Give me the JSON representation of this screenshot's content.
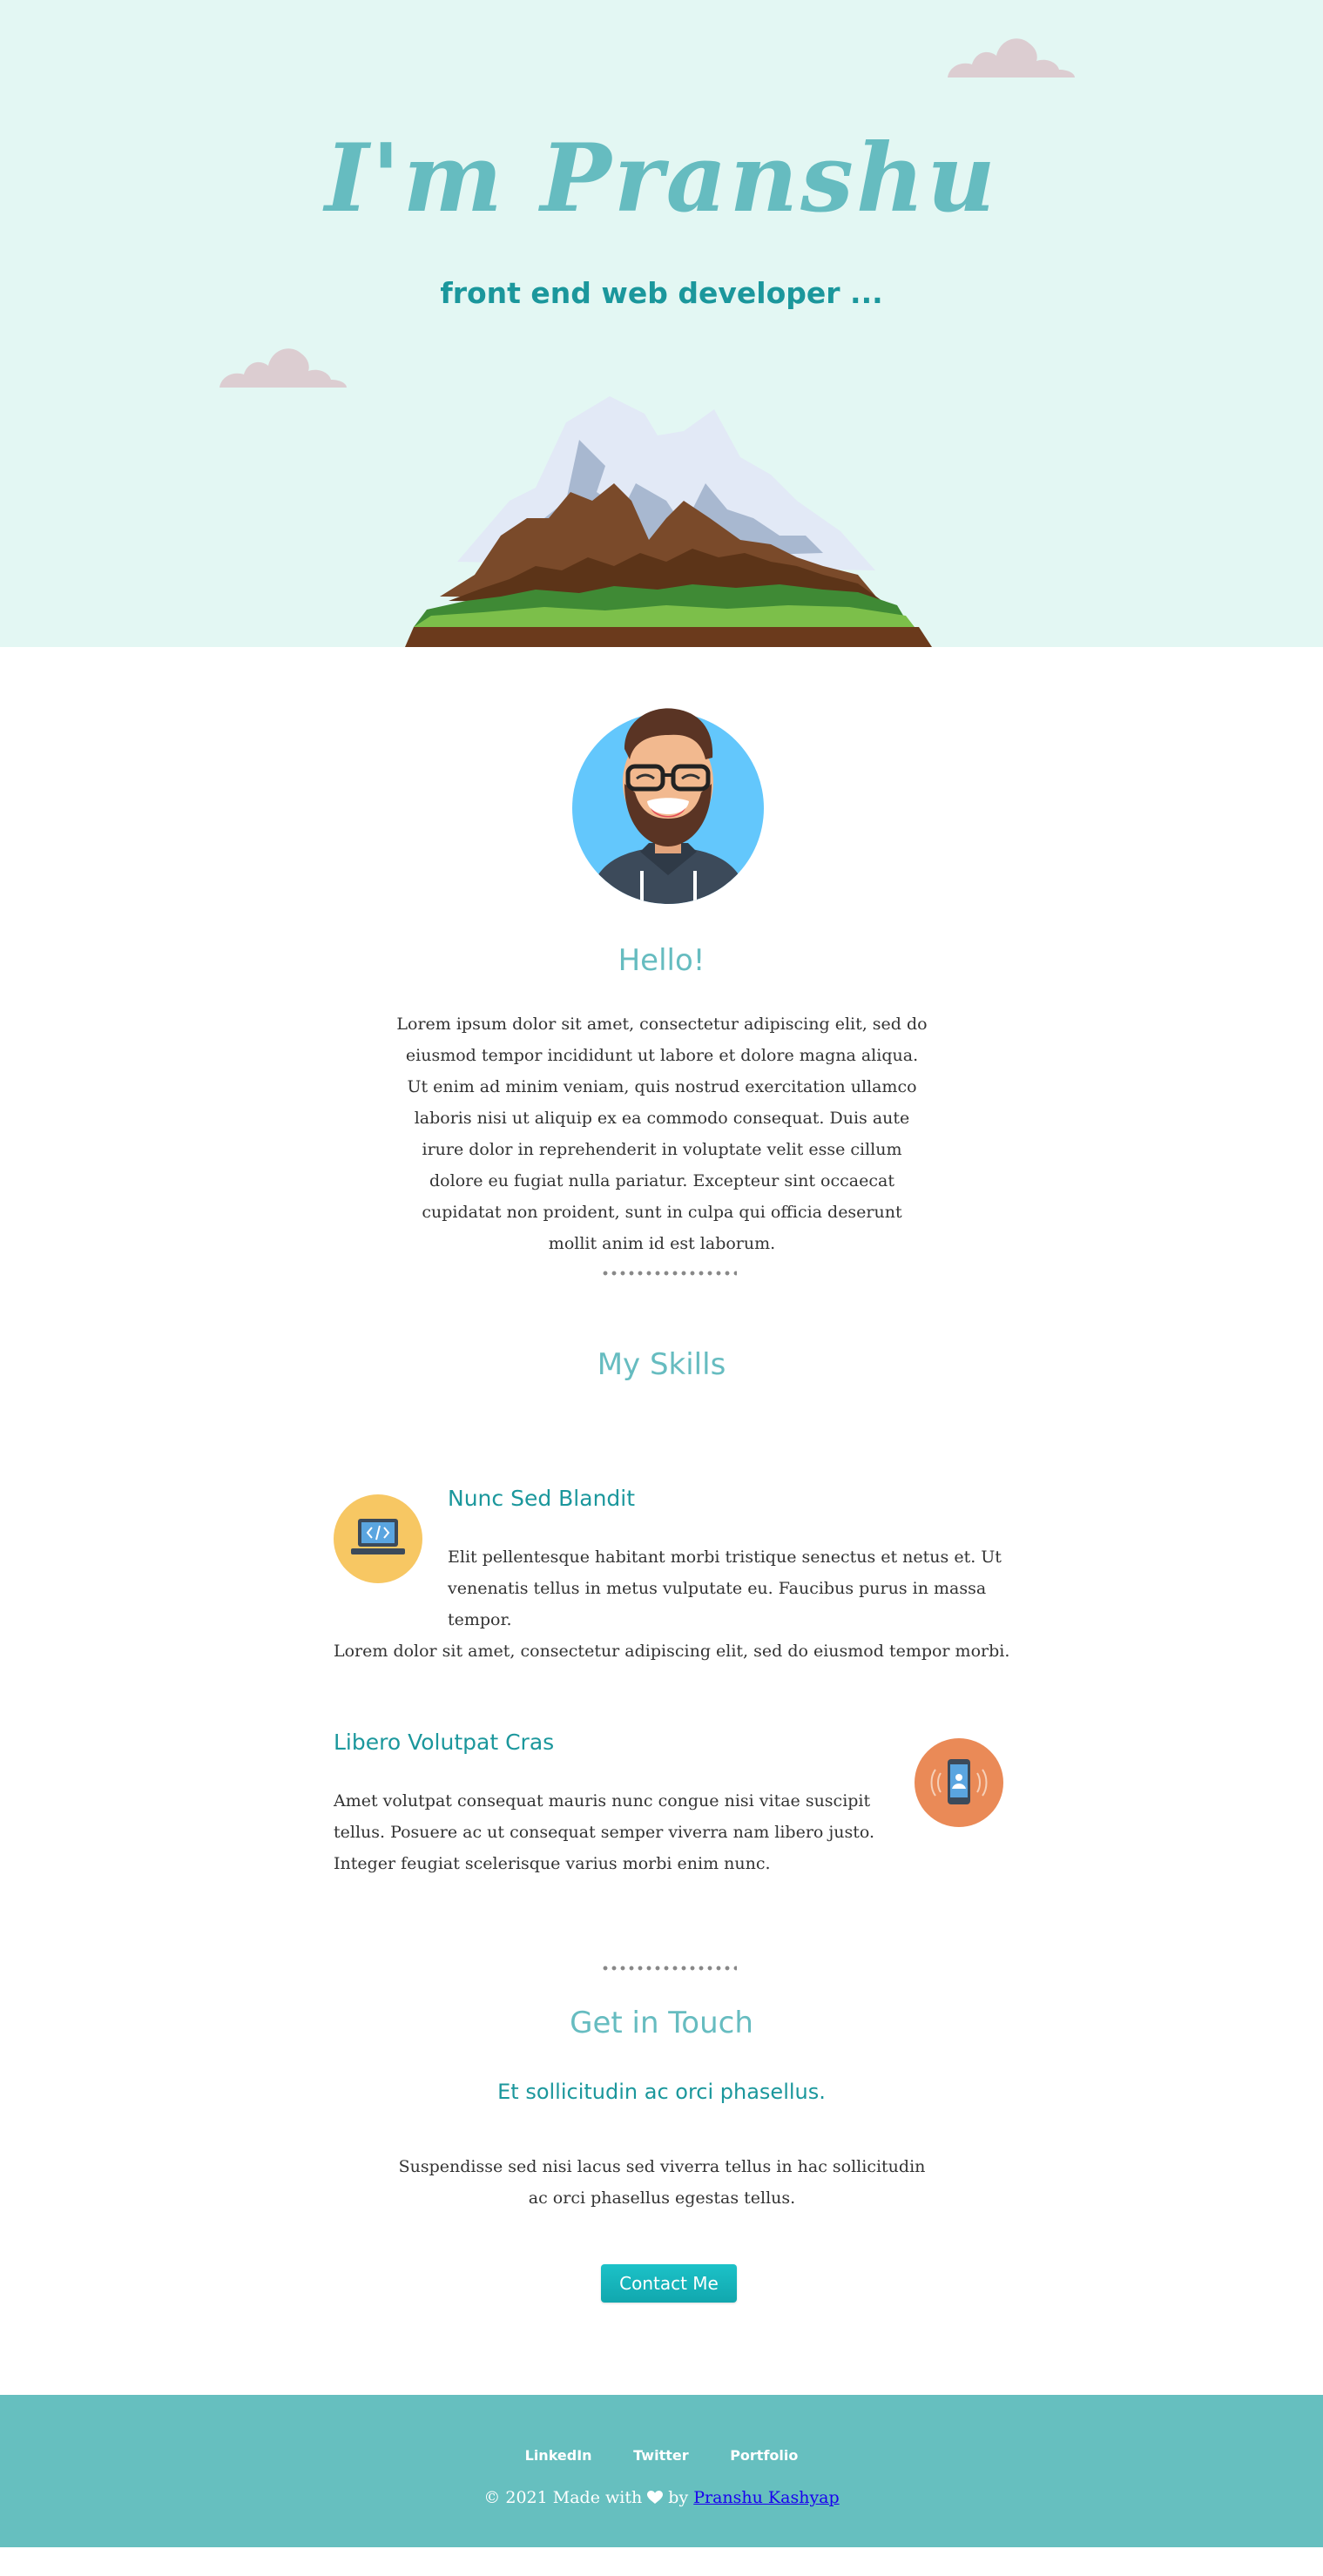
{
  "hero": {
    "title": "I'm Pranshu",
    "subtitle": "front end web developer ..."
  },
  "about": {
    "heading": "Hello!",
    "text": "Lorem ipsum dolor sit amet, consectetur adipiscing elit, sed do eiusmod tempor incididunt ut labore et dolore magna aliqua. Ut enim ad minim veniam, quis nostrud exercitation ullamco laboris nisi ut aliquip ex ea commodo consequat. Duis aute irure dolor in reprehenderit in voluptate velit esse cillum dolore eu fugiat nulla pariatur. Excepteur sint occaecat cupidatat non proident, sunt in culpa qui officia deserunt mollit anim id est laborum."
  },
  "skills": {
    "heading": "My Skills",
    "items": [
      {
        "title": "Nunc Sed Blandit",
        "text_line1": "Elit pellentesque habitant morbi tristique senectus et netus et. Ut",
        "text_line2": "venenatis tellus in metus vulputate eu. Faucibus purus in massa tempor.",
        "text_line3": "Lorem dolor sit amet, consectetur adipiscing elit, sed do eiusmod tempor morbi.",
        "icon": "laptop-code-icon",
        "icon_color": "#f7c763"
      },
      {
        "title": "Libero Volutpat Cras",
        "text": "Amet volutpat consequat mauris nunc congue nisi vitae suscipit tellus. Posuere ac ut consequat semper viverra nam libero justo. Integer feugiat scelerisque varius morbi enim nunc.",
        "icon": "smartphone-icon",
        "icon_color": "#ea8a57"
      }
    ]
  },
  "contact": {
    "heading": "Get in Touch",
    "subheading": "Et sollicitudin ac orci phasellus.",
    "text": "Suspendisse sed nisi lacus sed viverra tellus in hac sollicitudin ac orci phasellus egestas tellus.",
    "button_label": "Contact Me"
  },
  "footer": {
    "links": [
      "LinkedIn",
      "Twitter",
      "Portfolio"
    ],
    "copyright_prefix": "© 2021 Made with",
    "copyright_by": "by",
    "author": "Pranshu Kashyap"
  },
  "colors": {
    "hero_bg": "#e3f7f3",
    "accent": "#66bcc0",
    "dark_accent": "#1b979c",
    "footer_bg": "#66bfbf",
    "button": "#11a7ae"
  }
}
